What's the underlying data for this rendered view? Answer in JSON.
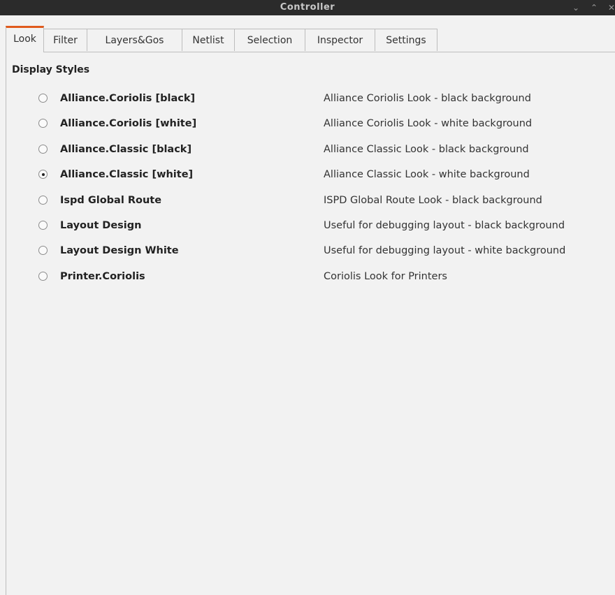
{
  "window": {
    "title": "Controller",
    "controls": [
      "⌄",
      "⌃",
      "✕"
    ]
  },
  "tabs": [
    {
      "label": "Look",
      "active": true
    },
    {
      "label": "Filter",
      "active": false
    },
    {
      "label": "Layers&Gos",
      "active": false
    },
    {
      "label": "Netlist",
      "active": false
    },
    {
      "label": "Selection",
      "active": false
    },
    {
      "label": "Inspector",
      "active": false
    },
    {
      "label": "Settings",
      "active": false
    }
  ],
  "look": {
    "section_title": "Display Styles",
    "styles": [
      {
        "name": "Alliance.Coriolis [black]",
        "description": "Alliance Coriolis Look - black background",
        "selected": false
      },
      {
        "name": "Alliance.Coriolis [white]",
        "description": "Alliance Coriolis Look - white background",
        "selected": false
      },
      {
        "name": "Alliance.Classic [black]",
        "description": "Alliance Classic Look - black background",
        "selected": false
      },
      {
        "name": "Alliance.Classic [white]",
        "description": "Alliance Classic Look - white background",
        "selected": true
      },
      {
        "name": "Ispd Global Route",
        "description": "ISPD Global Route Look - black background",
        "selected": false
      },
      {
        "name": "Layout Design",
        "description": "Useful for debugging layout - black background",
        "selected": false
      },
      {
        "name": "Layout Design White",
        "description": "Useful for debugging layout - white background",
        "selected": false
      },
      {
        "name": "Printer.Coriolis",
        "description": "Coriolis Look for Printers",
        "selected": false
      }
    ]
  },
  "colors": {
    "titlebar_bg": "#2b2b2b",
    "active_tab_accent": "#e05a1c",
    "window_bg": "#f2f2f2"
  }
}
